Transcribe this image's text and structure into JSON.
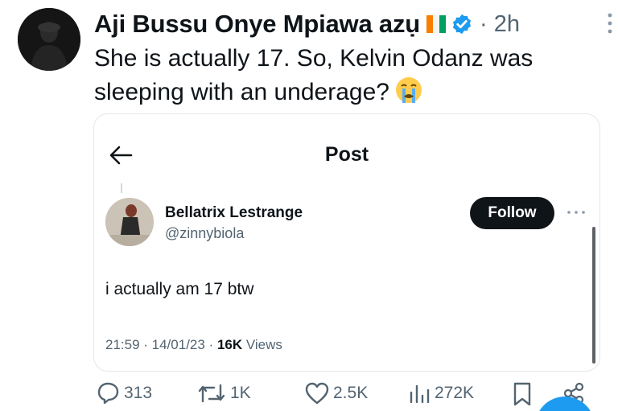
{
  "tweet": {
    "author_name": "Aji Bussu Onye Mpiawa azụ",
    "time": "· 2h",
    "text": "She is actually 17.  So, Kelvin Odanz was sleeping with an underage?",
    "flag_colors": [
      "#f77f00",
      "#ffffff",
      "#009e60"
    ],
    "accent_color": "#1d9bf0"
  },
  "quote": {
    "header_title": "Post",
    "display_name": "Bellatrix Lestrange",
    "handle": "@zinnybiola",
    "follow_label": "Follow",
    "body": "i actually am 17 btw",
    "time_date": "21:59 · 14/01/23 ·",
    "views_count": "16K",
    "views_label": "Views"
  },
  "actions": {
    "replies": "313",
    "reposts": "1K",
    "likes": "2.5K",
    "views": "272K"
  },
  "icons": [
    "more-icon",
    "verified-icon",
    "flag-icon",
    "crying-emoji-icon",
    "back-arrow-icon",
    "reply-icon",
    "repost-icon",
    "like-icon",
    "views-icon",
    "bookmark-icon",
    "share-icon"
  ]
}
